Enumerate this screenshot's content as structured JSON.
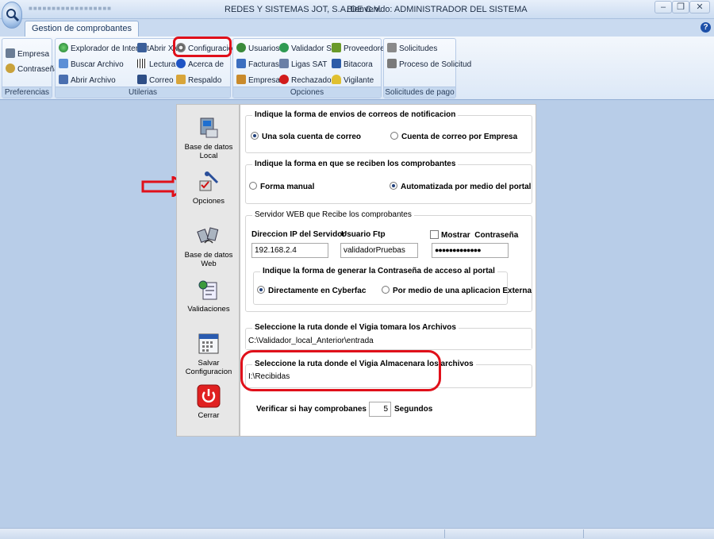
{
  "window": {
    "title": "REDES Y SISTEMAS JOT, S.A. DE C.V.",
    "welcome": "Bienvenido: ADMINISTRADOR DEL SISTEMA",
    "minimize": "–",
    "restore": "❐",
    "close": "✕"
  },
  "ribbon": {
    "active_tab": "Gestion de comprobantes",
    "help": "?",
    "groups": {
      "preferencias": {
        "label": "Preferencias",
        "items": [
          "Empresa",
          "Contraseña"
        ]
      },
      "utilerias": {
        "label": "Utilerias",
        "items": [
          "Explorador de Internet",
          "Buscar Archivo",
          "Abrir Archivo",
          "Abrir XML",
          "Lectura",
          "Correo",
          "Configuracion",
          "Acerca  de",
          "Respaldo"
        ]
      },
      "opciones": {
        "label": "Opciones",
        "items": [
          "Usuarios",
          "Facturas",
          "Empresas",
          "Validador SAT",
          "Ligas SAT",
          "Rechazados",
          "Proveedores",
          "Bitacora",
          "Vigilante"
        ]
      },
      "solicitudes": {
        "label": "Solicitudes de pago",
        "items": [
          "Solicitudes",
          "Proceso de Solicitud"
        ]
      }
    }
  },
  "nav": {
    "items": [
      "Base de datos Local",
      "Opciones",
      "Base de datos Web",
      "Validaciones",
      "Salvar Configuracion",
      "Cerrar"
    ]
  },
  "panel": {
    "correos": {
      "legend": "Indique la forma de envios de correos de notificacion",
      "opt1": "Una sola cuenta de correo",
      "opt2": "Cuenta de correo por Empresa",
      "selected": "opt1"
    },
    "recibir": {
      "legend": "Indique la forma en que se  reciben los comprobantes",
      "opt1": "Forma manual",
      "opt2": "Automatizada por medio del portal",
      "selected": "opt2"
    },
    "servidor": {
      "legend": "Servidor WEB que Recibe los comprobantes",
      "ip_label": "Direccion IP del Servidor",
      "ip_value": "192.168.2.4",
      "user_label": "Usuario Ftp",
      "user_value": "validadorPruebas",
      "show_label": "Mostrar",
      "pwd_label": "Contraseña",
      "pwd_value": "●●●●●●●●●●●●●",
      "acceso": {
        "legend": "Indique la forma de generar la Contraseña de acceso al portal",
        "opt1": "Directamente en Cyberfac",
        "opt2": "Por medio de una aplicacion Externa",
        "selected": "opt1"
      }
    },
    "ruta_tomar": {
      "legend": "Seleccione la ruta donde el Vigia tomara los  Archivos",
      "value": "C:\\Validador_local_Anterior\\entrada"
    },
    "ruta_guardar": {
      "legend": "Seleccione la ruta donde el Vigia Almacenara los archivos",
      "value": "I:\\Recibidas"
    },
    "verificar": {
      "label": "Verificar si hay comprobanes  cada",
      "value": "5",
      "unit": "Segundos"
    }
  },
  "colors": {
    "accent_red": "#e0101a",
    "ribbon_blue": "#c5d8ef",
    "workspace": "#b8cde8"
  }
}
